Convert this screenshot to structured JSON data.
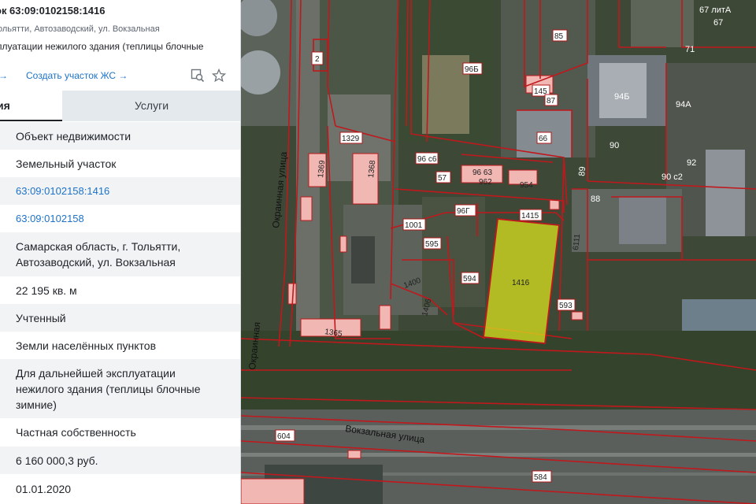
{
  "panel": {
    "title": "ок 63:09:0102158:1416",
    "address": "ольятти, Автозаводский, ул. Вокзальная",
    "purpose": "плуатации нежилого здания (теплицы блочные",
    "actions": {
      "link_partial": "→",
      "create_zhs": "Создать участок ЖС →",
      "search_map_icon": "map-search-icon",
      "favorite_icon": "star-icon"
    },
    "tabs": {
      "active": "ия",
      "services": "Услуги"
    },
    "rows": [
      {
        "text": "Объект недвижимости",
        "kind": "text"
      },
      {
        "text": "Земельный участок",
        "kind": "text"
      },
      {
        "text": "63:09:0102158:1416",
        "kind": "link"
      },
      {
        "text": "63:09:0102158",
        "kind": "link"
      },
      {
        "text": "Самарская область, г. Тольятти, Автозаводский, ул. Вокзальная",
        "kind": "text"
      },
      {
        "text": "22 195 кв. м",
        "kind": "text"
      },
      {
        "text": "Учтенный",
        "kind": "text"
      },
      {
        "text": "Земли населённых пунктов",
        "kind": "text"
      },
      {
        "text": "Для дальнейшей эксплуатации нежилого здания (теплицы блочные зимние)",
        "kind": "text"
      },
      {
        "text": "Частная собственность",
        "kind": "text"
      },
      {
        "text": "6 160 000,3 руб.",
        "kind": "text"
      },
      {
        "text": "01.01.2020",
        "kind": "text"
      }
    ]
  },
  "map": {
    "streets": {
      "okrainnaya": "Окраинная улица",
      "vokzalnaya": "Вокзальная улица",
      "okrainnaya_bottom": "Окраинная"
    },
    "parcel_labels": {
      "p2": "2",
      "p85": "85",
      "p67": "67 литА",
      "p71": "71",
      "p96b": "96Б",
      "p145": "145",
      "p87": "87",
      "p94b": "94Б",
      "p94a": "94А",
      "p66": "66",
      "p90": "90",
      "p92": "92",
      "p1329": "1329",
      "p1369": "1369",
      "p1368": "1368",
      "p96c6": "96 с6",
      "p96_63": "96 63",
      "p962": "962",
      "p57": "57",
      "p954": "954",
      "p89": "89",
      "p88": "88",
      "p90c2": "90 с2",
      "p96g": "96Г",
      "p1415": "1415",
      "p1001": "1001",
      "p595": "595",
      "p6111": "6111",
      "p1400": "1400",
      "p594": "594",
      "p1416": "1416",
      "p593": "593",
      "p1406": "1406",
      "p1365": "1365",
      "p604": "604",
      "p584": "584",
      "p67b": "67"
    },
    "selected_parcel_color": "#d9e21e",
    "boundary_color": "#c0181c"
  }
}
